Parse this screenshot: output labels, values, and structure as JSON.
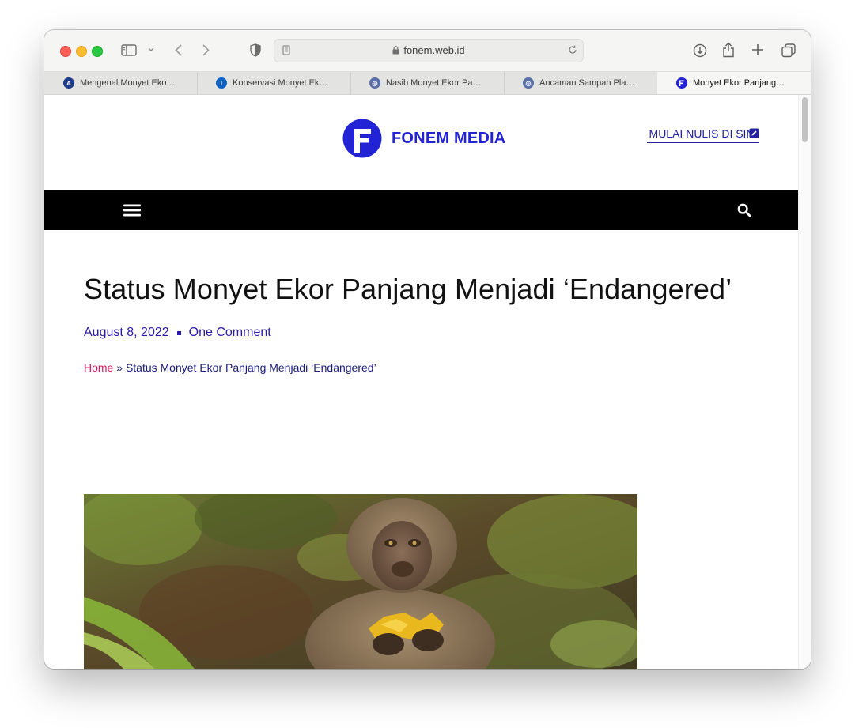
{
  "browser": {
    "url": "fonem.web.id",
    "tabs": [
      {
        "label": "Mengenal Monyet Eko…",
        "favicon_color": "#1e3a8a",
        "active": false
      },
      {
        "label": "Konservasi Monyet Ek…",
        "favicon_color": "#0e62c4",
        "active": false
      },
      {
        "label": "Nasib Monyet Ekor Pa…",
        "favicon_color": "#5a6ea8",
        "active": false
      },
      {
        "label": "Ancaman Sampah Pla…",
        "favicon_color": "#5a6ea8",
        "active": false
      },
      {
        "label": "Monyet Ekor Panjang…",
        "favicon_color": "#2323d6",
        "active": true
      }
    ],
    "icons": [
      "sidebar-icon",
      "chevron-down-icon",
      "back-icon",
      "forward-icon",
      "privacy-shield-icon",
      "reader-icon",
      "lock-icon",
      "reload-icon",
      "download-icon",
      "share-icon",
      "new-tab-icon",
      "tab-overview-icon"
    ]
  },
  "site": {
    "logo_text": "FONEM MEDIA",
    "cta_label": "MULAI NULIS DI SINI",
    "brand_color": "#2323d6",
    "nav": {
      "menu_icon": "hamburger-icon",
      "search_icon": "search-icon"
    }
  },
  "article": {
    "title": "Status Monyet Ekor Panjang Menjadi ‘Endangered’",
    "date": "August 8, 2022",
    "comments": "One Comment",
    "breadcrumb": {
      "home": "Home",
      "separator": "»",
      "current": "Status Monyet Ekor Panjang Menjadi ‘Endangered’"
    },
    "image_subject": "long-tailed macaque eating fruit"
  }
}
